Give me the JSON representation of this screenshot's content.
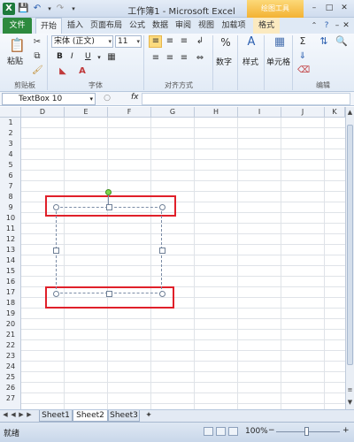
{
  "window": {
    "title": "工作簿1 - Microsoft Excel",
    "context_tools": "绘图工具",
    "app_icon": "X",
    "qa_icons": [
      "save-icon",
      "undo-icon",
      "redo-icon",
      "customize-icon"
    ]
  },
  "tabs": [
    {
      "label": "文件",
      "id": "file"
    },
    {
      "label": "开始",
      "id": "home"
    },
    {
      "label": "插入",
      "id": "insert"
    },
    {
      "label": "页面布局",
      "id": "page-layout"
    },
    {
      "label": "公式",
      "id": "formulas"
    },
    {
      "label": "数据",
      "id": "data"
    },
    {
      "label": "审阅",
      "id": "review"
    },
    {
      "label": "视图",
      "id": "view"
    },
    {
      "label": "加载项",
      "id": "addins"
    },
    {
      "label": "格式",
      "id": "format"
    }
  ],
  "ribbon": {
    "paste_label": "粘贴",
    "clipboard_label": "剪贴板",
    "font_name": "宋体 (正文)",
    "font_size": "11",
    "bold": "B",
    "italic": "I",
    "underline": "U",
    "font_group_label": "字体",
    "align_group_label": "对齐方式",
    "number_label": "数字",
    "styles_label": "样式",
    "cells_label": "单元格",
    "editing_label": "编辑",
    "percent_icon": "%",
    "sum_icon": "Σ"
  },
  "formula_bar": {
    "name_box": "TextBox 10",
    "fx": "fx",
    "value": ""
  },
  "columns": [
    "D",
    "E",
    "F",
    "G",
    "H",
    "I",
    "J",
    "K"
  ],
  "rows": [
    "1",
    "2",
    "3",
    "4",
    "5",
    "6",
    "7",
    "8",
    "9",
    "10",
    "11",
    "12",
    "13",
    "14",
    "15",
    "16",
    "17",
    "18",
    "19",
    "20",
    "21",
    "22",
    "23",
    "24",
    "25",
    "26",
    "27"
  ],
  "sheets": [
    {
      "label": "Sheet1",
      "active": false
    },
    {
      "label": "Sheet2",
      "active": true
    },
    {
      "label": "Sheet3",
      "active": false
    }
  ],
  "status": {
    "ready": "就绪",
    "zoom": "100%",
    "zoom_out": "−",
    "zoom_in": "+"
  },
  "colors": {
    "file_tab": "#2d8a3e",
    "context_tools": "#f3b233",
    "highlight": "#e0202a"
  }
}
